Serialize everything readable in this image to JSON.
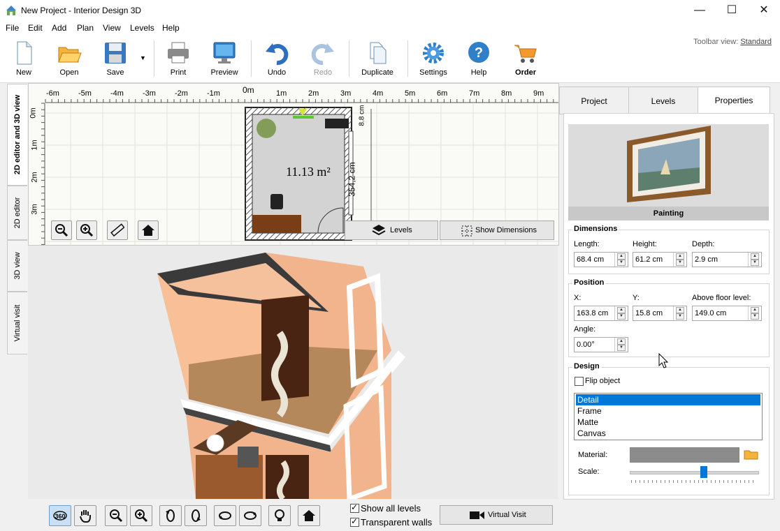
{
  "window": {
    "title": "New Project - Interior Design 3D",
    "buttons": [
      "minimize",
      "maximize",
      "close"
    ]
  },
  "menu": [
    "File",
    "Edit",
    "Add",
    "Plan",
    "View",
    "Levels",
    "Help"
  ],
  "toolbar": {
    "items": [
      {
        "label": "New",
        "icon": "new-document-icon"
      },
      {
        "label": "Open",
        "icon": "open-folder-icon"
      },
      {
        "label": "Save",
        "icon": "save-disk-icon"
      },
      {
        "label": "Print",
        "icon": "printer-icon"
      },
      {
        "label": "Preview",
        "icon": "monitor-preview-icon"
      },
      {
        "label": "Undo",
        "icon": "undo-arrow-icon"
      },
      {
        "label": "Redo",
        "icon": "redo-arrow-icon",
        "disabled": true
      },
      {
        "label": "Duplicate",
        "icon": "duplicate-pages-icon"
      },
      {
        "label": "Settings",
        "icon": "gear-icon"
      },
      {
        "label": "Help",
        "icon": "help-question-icon"
      },
      {
        "label": "Order",
        "icon": "shopping-cart-icon"
      }
    ],
    "view_label": "Toolbar view:",
    "view_value": "Standard"
  },
  "left_tabs": [
    "2D editor and 3D view",
    "2D editor",
    "3D view",
    "Virtual visit"
  ],
  "plan2d": {
    "ruler_x": [
      "-6m",
      "-5m",
      "-4m",
      "-3m",
      "-2m",
      "-1m",
      "0m",
      "1m",
      "2m",
      "3m",
      "4m",
      "5m",
      "6m",
      "7m",
      "8m",
      "9m"
    ],
    "ruler_y": [
      "0m",
      "1m",
      "2m",
      "3m"
    ],
    "area_label": "11.13 m²",
    "dim_vertical": "354,2 cm",
    "dim_top": "8.8 cm",
    "levels_button": "Levels",
    "show_dimensions_button": "Show Dimensions"
  },
  "view3d": {
    "show_all_levels": {
      "label": "Show all levels",
      "checked": true
    },
    "transparent_walls": {
      "label": "Transparent walls",
      "checked": true
    },
    "virtual_visit_button": "Virtual Visit"
  },
  "right_panel": {
    "tabs": [
      "Project",
      "Levels",
      "Properties"
    ],
    "active_tab": "Properties",
    "object_name": "Painting",
    "dimensions": {
      "title": "Dimensions",
      "length_label": "Length:",
      "length": "68.4 cm",
      "height_label": "Height:",
      "height": "61.2 cm",
      "depth_label": "Depth:",
      "depth": "2.9 cm"
    },
    "position": {
      "title": "Position",
      "x_label": "X:",
      "x": "163.8 cm",
      "y_label": "Y:",
      "y": "15.8 cm",
      "above_label": "Above floor level:",
      "above": "149.0 cm",
      "angle_label": "Angle:",
      "angle": "0.00°"
    },
    "design": {
      "title": "Design",
      "flip_label": "Flip object",
      "flip_checked": false,
      "parts": [
        "Detail",
        "Frame",
        "Matte",
        "Canvas"
      ],
      "selected_part": "Detail",
      "material_label": "Material:",
      "material_color": "#8c8c8c",
      "scale_label": "Scale:",
      "scale_fraction": 0.58
    }
  },
  "colors": {
    "accent": "#0078d7",
    "wall": "#3c3c3c",
    "floor": "#b5885c",
    "interior_wall": "#f2b48c"
  }
}
